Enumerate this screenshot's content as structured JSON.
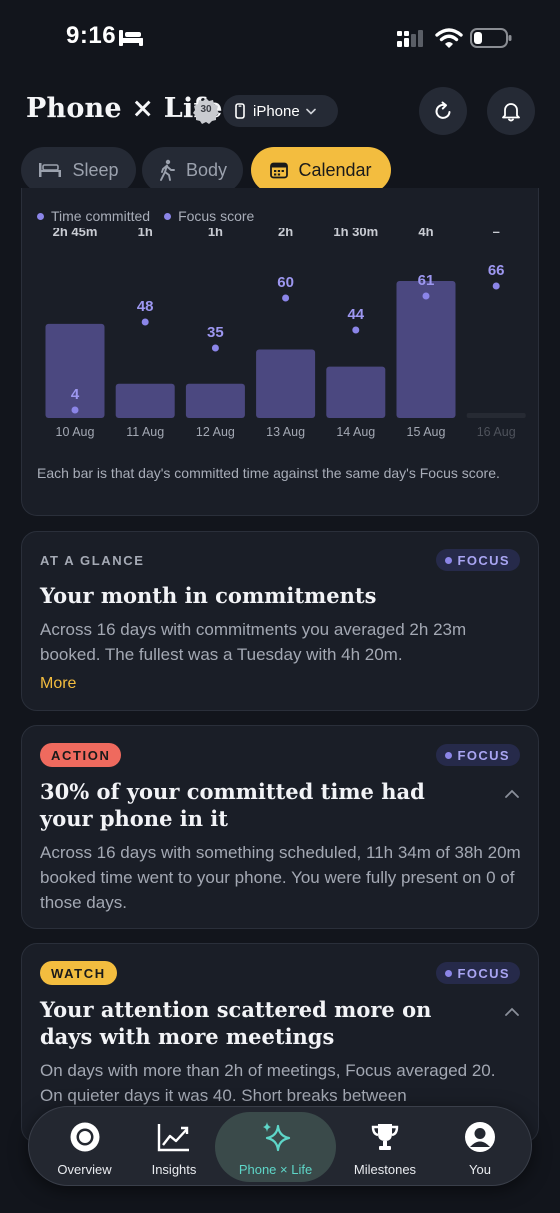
{
  "status": {
    "time": "9:16"
  },
  "header": {
    "title": "Phone × Life",
    "level_badge": "30",
    "device": "iPhone"
  },
  "tabs": [
    {
      "label": "Sleep",
      "icon": "bed-icon",
      "active": false
    },
    {
      "label": "Body",
      "icon": "walking-icon",
      "active": false
    },
    {
      "label": "Calendar",
      "icon": "calendar-icon",
      "active": true
    }
  ],
  "chart_card": {
    "legend": [
      "Time committed",
      "Focus score"
    ],
    "caption": "Each bar is that day's committed time against the same day's Focus score."
  },
  "chart_data": {
    "type": "bar",
    "categories": [
      "10 Aug",
      "11 Aug",
      "12 Aug",
      "13 Aug",
      "14 Aug",
      "15 Aug",
      "16 Aug"
    ],
    "series": [
      {
        "name": "Time committed",
        "labels": [
          "2h 45m",
          "1h",
          "1h",
          "2h",
          "1h 30m",
          "4h",
          "–"
        ],
        "values": [
          2.75,
          1,
          1,
          2,
          1.5,
          4,
          0
        ]
      },
      {
        "name": "Focus score",
        "values": [
          4,
          48,
          35,
          60,
          44,
          61,
          66
        ]
      }
    ],
    "bar_color": "#4b4880",
    "dot_color": "#8b85e8",
    "muted_category": "16 Aug"
  },
  "glance_card": {
    "kicker": "AT A GLANCE",
    "tag": "FOCUS",
    "title": "Your month in commitments",
    "body": "Across 16 days with commitments you averaged 2h 23m booked. The fullest was a Tuesday with 4h 20m.",
    "more": "More"
  },
  "action_card": {
    "badge": "ACTION",
    "tag": "FOCUS",
    "title": "30% of your committed time had your phone in it",
    "body": "Across 16 days with something scheduled, 11h 34m of 38h 20m booked time went to your phone. You were fully present on 0 of those days."
  },
  "watch_card": {
    "badge": "WATCH",
    "tag": "FOCUS",
    "title": "Your attention scattered more on days with more meetings",
    "body": "On days with more than 2h of meetings, Focus averaged 20. On quieter days it was 40. Short breaks between"
  },
  "nav": [
    {
      "label": "Overview",
      "icon": "overview-icon",
      "active": false
    },
    {
      "label": "Insights",
      "icon": "chart-line-icon",
      "active": false
    },
    {
      "label": "Phone × Life",
      "icon": "sparkles-icon",
      "active": true
    },
    {
      "label": "Milestones",
      "icon": "trophy-icon",
      "active": false
    },
    {
      "label": "You",
      "icon": "user-icon",
      "active": false
    }
  ]
}
